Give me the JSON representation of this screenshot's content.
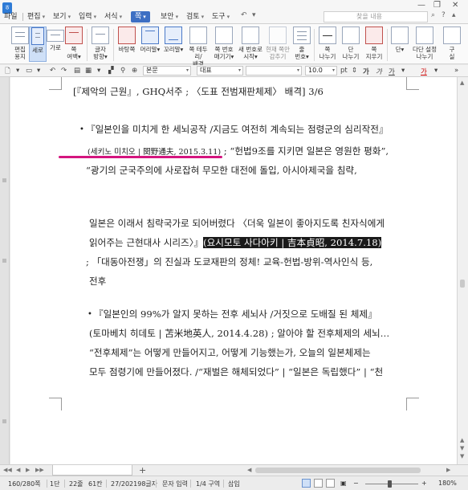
{
  "menubar": {
    "app_icon": "hwp-logo",
    "items": [
      {
        "label": "파일",
        "caret": false
      },
      {
        "label": "편집",
        "caret": true
      },
      {
        "label": "보기",
        "caret": true
      },
      {
        "label": "입력",
        "caret": true
      },
      {
        "label": "서식",
        "caret": true
      },
      {
        "label": "쪽",
        "caret": true
      },
      {
        "label": "보안",
        "caret": true
      },
      {
        "label": "검토",
        "caret": true
      },
      {
        "label": "도구",
        "caret": true
      }
    ],
    "active_item": "쪽",
    "search_placeholder": "찾을 내용",
    "caret_glyph": "▾"
  },
  "ribbon": {
    "buttons": [
      {
        "label": "편집\n용지",
        "icon": "page-setup-icon"
      },
      {
        "label": "세로",
        "icon": "portrait-icon",
        "selected": true
      },
      {
        "label": "가로",
        "icon": "landscape-icon"
      },
      {
        "label": "쪽\n여백▾",
        "icon": "page-margin-icon"
      },
      {
        "label": "글자\n방향▾",
        "icon": "text-direction-icon"
      },
      {
        "label": "바탕쪽",
        "icon": "master-page-icon"
      },
      {
        "label": "머리말▾",
        "icon": "header-icon"
      },
      {
        "label": "꼬리말▾",
        "icon": "footer-icon"
      },
      {
        "label": "쪽 테두리/\n배경",
        "icon": "page-border-icon"
      },
      {
        "label": "쪽 번호\n매기기▾",
        "icon": "page-number-icon"
      },
      {
        "label": "새 번호로\n시작▾",
        "icon": "new-number-icon"
      },
      {
        "label": "현재 쪽만\n감추기",
        "icon": "hide-page-icon"
      },
      {
        "label": "줄\n번호▾",
        "icon": "line-number-icon"
      },
      {
        "label": "쪽\n나누기",
        "icon": "page-break-icon"
      },
      {
        "label": "단\n나누기",
        "icon": "column-break-icon"
      },
      {
        "label": "쪽\n지우기",
        "icon": "delete-page-icon"
      },
      {
        "label": "단▾",
        "icon": "columns-icon"
      },
      {
        "label": "다단 설정\n나누기",
        "icon": "multi-column-icon"
      },
      {
        "label": "구\n실",
        "icon": "more-icon"
      }
    ]
  },
  "formatbar": {
    "style_value": "본문",
    "font_value": "대표",
    "size_value": "10.0",
    "size_unit": "pt"
  },
  "document": {
    "lines": [
      {
        "text": "[『제악의 근원』, GHQ서주 ; 〈도표 전범재판체제〉 배격] 3/6"
      },
      {
        "text": "『일본인을 미치게 한 세뇌공작 /지금도 여전히 계속되는 점령군의 심리작전』"
      },
      {
        "pre": "(세키노 미치오 | 関野通夫, 2015.3.11)",
        "post": " ; “헌법9조를 지키면 일본은 영원한 평화”,"
      },
      {
        "text": "“광기의 군국주의에 사로잡혀 무모한 대전에 돌입, 아시아제국을 침략,"
      },
      {
        "text": "일본은 이래서 침략국가로 되어버렸다 〈더욱 일본이 좋아지도록 친자식에게"
      },
      {
        "pre": "읽어주는 근현대사 시리즈〉』",
        "hl": "(요시모토 사다아키 | 吉本貞昭, 2014.7.18)"
      },
      {
        "text": "; 「대동아전쟁」의 진실과 도쿄재판의 정체! 교육-헌법-방위-역사인식 등,"
      },
      {
        "text": "전후"
      },
      {
        "text": "『일본인의 99%가 알지 못하는 전후 세뇌사 /거짓으로 도배질 된 체제』"
      },
      {
        "text": "(토마베치 히데토 | 苫米地英人, 2014.4.28) ; 알아야 할 전후체제의 세뇌…"
      },
      {
        "text": "“전후체제”는 어떻게 만들어지고, 어떻게 기능했는가, 오늘의 일본체제는"
      },
      {
        "text": "모두 점령기에 만들어졌다. /“재벌은 해체되었다” | “일본은 독립했다” | “천"
      }
    ],
    "bullet": "•"
  },
  "statusbar": {
    "page": "160/280쪽",
    "section": "1단",
    "line": "22줄",
    "column": "61칸",
    "chars": "27/202198글자",
    "mode": "문자 입력",
    "layout": "1/4 구역",
    "insert": "삽입",
    "zoom": "180%",
    "zoom_level_fraction": 0.45
  }
}
